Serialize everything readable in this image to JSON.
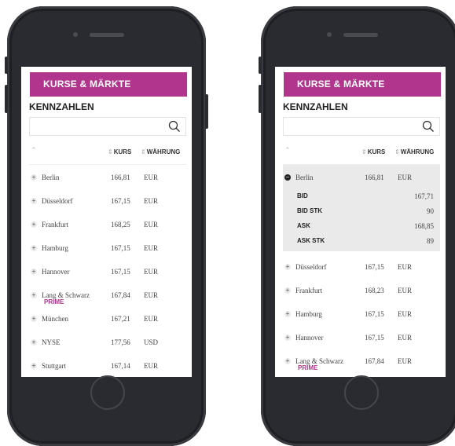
{
  "banner": "KURSE & MÄRKTE",
  "section_title": "KENNZAHLEN",
  "search": {
    "placeholder": ""
  },
  "columns": {
    "kurs": "KURS",
    "waehrung": "WÄHRUNG"
  },
  "left_rows": [
    {
      "name": "Berlin",
      "kurs": "166,81",
      "waehrung": "EUR"
    },
    {
      "name": "Düsseldorf",
      "kurs": "167,15",
      "waehrung": "EUR"
    },
    {
      "name": "Frankfurt",
      "kurs": "168,25",
      "waehrung": "EUR"
    },
    {
      "name": "Hamburg",
      "kurs": "167,15",
      "waehrung": "EUR"
    },
    {
      "name": "Hannover",
      "kurs": "167,15",
      "waehrung": "EUR"
    },
    {
      "name": "Lang & Schwarz",
      "prime": "PRIME",
      "kurs": "167,84",
      "waehrung": "EUR"
    },
    {
      "name": "München",
      "kurs": "167,21",
      "waehrung": "EUR"
    },
    {
      "name": "NYSE",
      "kurs": "177,56",
      "waehrung": "USD"
    },
    {
      "name": "Stuttgart",
      "kurs": "167,14",
      "waehrung": "EUR"
    }
  ],
  "expanded": {
    "name": "Berlin",
    "kurs": "166,81",
    "waehrung": "EUR",
    "details": [
      {
        "label": "BID",
        "value": "167,71"
      },
      {
        "label": "BID STK",
        "value": "90"
      },
      {
        "label": "ASK",
        "value": "168,85"
      },
      {
        "label": "ASK STK",
        "value": "89"
      }
    ]
  },
  "right_rows": [
    {
      "name": "Düsseldorf",
      "kurs": "167,15",
      "waehrung": "EUR"
    },
    {
      "name": "Frankfurt",
      "kurs": "168,23",
      "waehrung": "EUR"
    },
    {
      "name": "Hamburg",
      "kurs": "167,15",
      "waehrung": "EUR"
    },
    {
      "name": "Hannover",
      "kurs": "167,15",
      "waehrung": "EUR"
    },
    {
      "name": "Lang & Schwarz",
      "prime": "PRIME",
      "kurs": "167,84",
      "waehrung": "EUR"
    }
  ],
  "icons": {
    "search": "search-icon",
    "expand": "plus-icon",
    "collapse": "minus-icon",
    "sort": "sort-icon"
  },
  "colors": {
    "accent": "#b2358d",
    "phone": "#2a2b30"
  }
}
